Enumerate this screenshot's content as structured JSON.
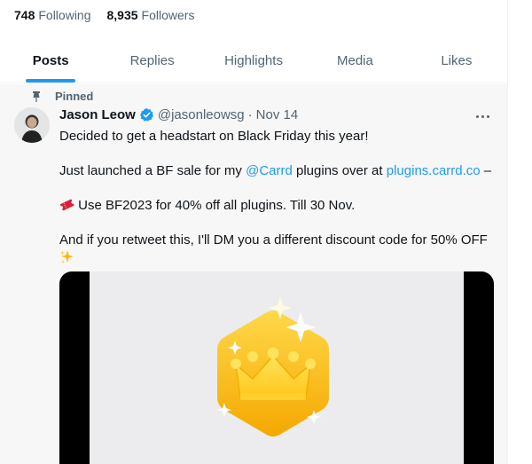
{
  "profile": {
    "following_count": "748",
    "following_label": "Following",
    "followers_count": "8,935",
    "followers_label": "Followers"
  },
  "tabs": [
    {
      "label": "Posts",
      "active": true
    },
    {
      "label": "Replies",
      "active": false
    },
    {
      "label": "Highlights",
      "active": false
    },
    {
      "label": "Media",
      "active": false
    },
    {
      "label": "Likes",
      "active": false
    }
  ],
  "tweet": {
    "pinned_label": "Pinned",
    "author_name": "Jason Leow",
    "handle": "@jasonleowsg",
    "separator": "·",
    "date": "Nov 14",
    "line1": "Decided to get a headstart on Black Friday this year!",
    "line2_prefix": "Just launched a BF sale for my ",
    "line2_mention": "@Carrd",
    "line2_middle": " plugins over at ",
    "line2_link": "plugins.carrd.co",
    "line2_suffix": " –",
    "line3": " Use BF2023 for 40% off all plugins. Till 30 Nov.",
    "line4": "And if you retweet this, I'll DM you a different discount code for 50% OFF",
    "icons": {
      "pin": "pin-icon",
      "verified": "verified-badge-icon",
      "ticket": "ticket-emoji",
      "sparkles": "sparkles-emoji",
      "more": "more-options-icon"
    }
  },
  "colors": {
    "accent": "#1d9bf0",
    "muted": "#536471",
    "text": "#0f1419",
    "badge_gold": "#f5b301"
  }
}
